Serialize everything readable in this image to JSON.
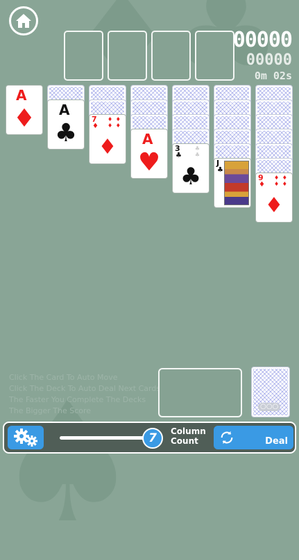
{
  "colors": {
    "table": "#89a596",
    "accent": "#3a9ae4",
    "red_suit": "#ee1c1c",
    "black_suit": "#111111"
  },
  "header": {
    "home_icon": "home-icon",
    "score": "00000",
    "moves": "00000",
    "time": "0m 02s"
  },
  "foundations": [
    "",
    "",
    "",
    ""
  ],
  "tableau": [
    {
      "face_down": 0,
      "face_up": {
        "rank": "A",
        "suit": "♦",
        "color": "red"
      }
    },
    {
      "face_down": 1,
      "face_up": {
        "rank": "A",
        "suit": "♣",
        "color": "black"
      }
    },
    {
      "face_down": 2,
      "face_up": {
        "rank": "7",
        "suit": "♦",
        "color": "red"
      }
    },
    {
      "face_down": 3,
      "face_up": {
        "rank": "A",
        "suit": "♥",
        "color": "red"
      }
    },
    {
      "face_down": 4,
      "face_up": {
        "rank": "3",
        "suit": "♣",
        "color": "black"
      }
    },
    {
      "face_down": 5,
      "face_up": {
        "rank": "J",
        "suit": "♣",
        "color": "black"
      }
    },
    {
      "face_down": 6,
      "face_up": {
        "rank": "9",
        "suit": "♦",
        "color": "red"
      }
    }
  ],
  "hints": [
    "Click The Card To Auto Move",
    "Click The Deck To Auto Deal Next Cards",
    "The Faster You Complete The Decks",
    "The Bigger The Score"
  ],
  "stock": {
    "remaining_indicator": "○○○"
  },
  "toolbar": {
    "settings_icon": "gears-icon",
    "column_count": "7",
    "column_count_fraction": 1.0,
    "column_label_line1": "Column",
    "column_label_line2": "Count",
    "deal_icon": "refresh-icon",
    "deal_label": "Deal"
  }
}
